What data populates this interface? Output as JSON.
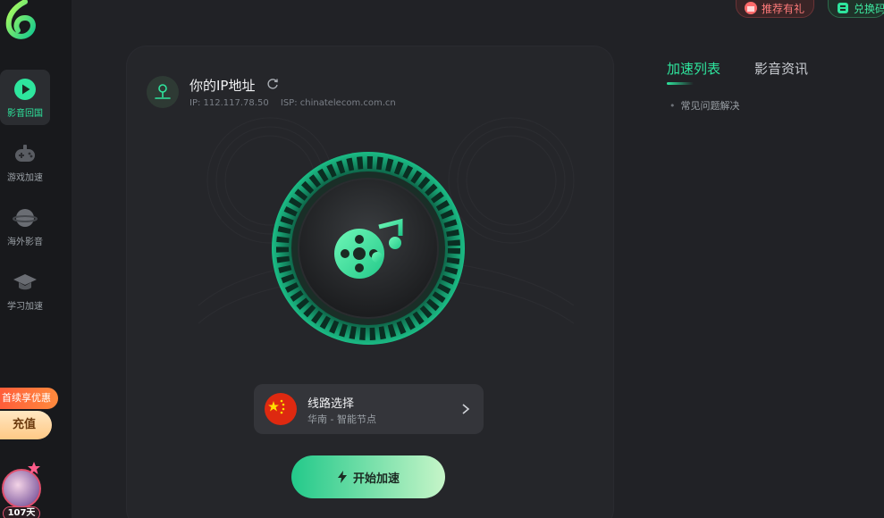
{
  "sidebar": {
    "items": [
      {
        "label": "影音回国",
        "icon": "play-circle-icon",
        "active": true
      },
      {
        "label": "游戏加速",
        "icon": "gamepad-icon",
        "active": false
      },
      {
        "label": "海外影音",
        "icon": "planet-icon",
        "active": false
      },
      {
        "label": "学习加速",
        "icon": "graduation-cap-icon",
        "active": false
      }
    ],
    "promo_tag": "首续享优惠",
    "recharge_label": "充值",
    "days_label": "107天"
  },
  "top_buttons": {
    "refer_label": "推荐有礼",
    "redeem_label": "兑换码"
  },
  "ip_panel": {
    "title": "你的IP地址",
    "ip": "IP: 112.117.78.50",
    "isp": "ISP: chinatelecom.com.cn"
  },
  "route": {
    "title": "线路选择",
    "subtitle": "华南 - 智能节点"
  },
  "start_button": "开始加速",
  "right_panel": {
    "tabs": [
      {
        "label": "加速列表",
        "active": true
      },
      {
        "label": "影音资讯",
        "active": false
      }
    ],
    "faq_item": "常见问题解决"
  },
  "colors": {
    "accent": "#2ee59d",
    "background": "#212226",
    "card": "#25262a",
    "sidebar": "#18191c"
  }
}
